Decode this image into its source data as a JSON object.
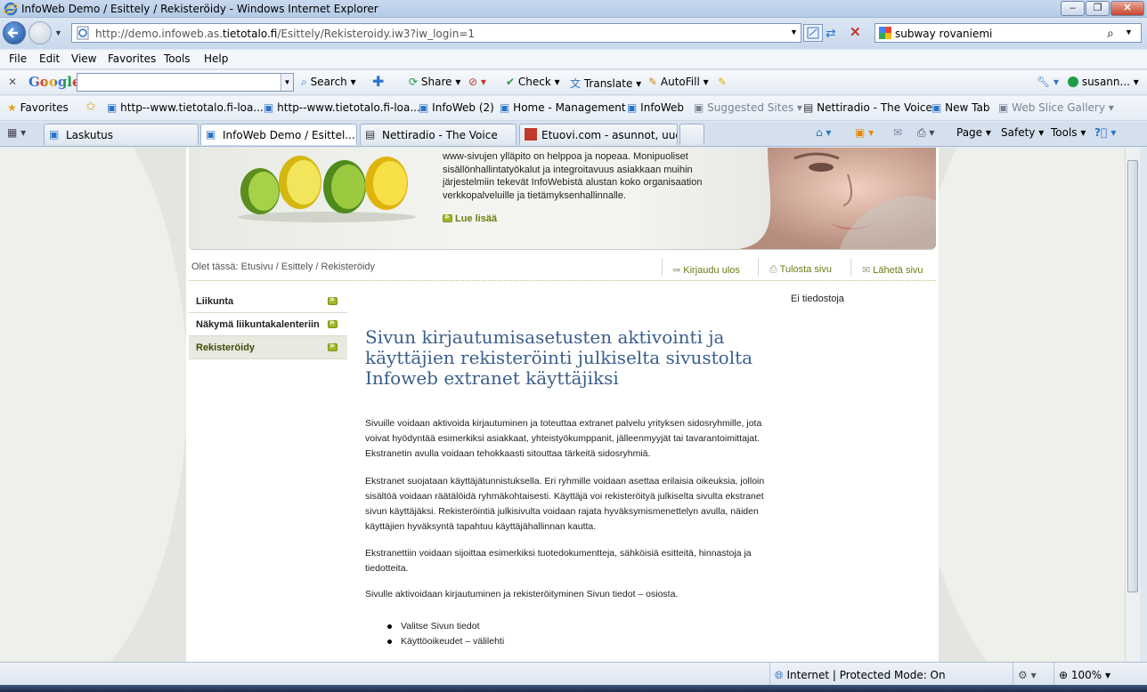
{
  "window": {
    "title": "InfoWeb Demo / Esittely / Rekisteröidy - Windows Internet Explorer"
  },
  "address": {
    "url_prefix": "http://demo.infoweb.as.",
    "url_domain": "tietotalo.fi",
    "url_suffix": "/Esittely/Rekisteroidy.iw3?iw_login=1"
  },
  "search": {
    "value": "subway rovaniemi"
  },
  "menu": [
    "File",
    "Edit",
    "View",
    "Favorites",
    "Tools",
    "Help"
  ],
  "google_toolbar": {
    "logo": "Google",
    "search_label": "Search",
    "share_label": "Share",
    "check_label": "Check",
    "translate_label": "Translate",
    "autofill_label": "AutoFill",
    "user_label": "susann..."
  },
  "favorites": {
    "label": "Favorites",
    "items": [
      "http--www.tietotalo.fi-loa...",
      "http--www.tietotalo.fi-loa...",
      "InfoWeb (2)",
      "Home - Management",
      "InfoWeb",
      "Suggested Sites",
      "Nettiradio - The Voice",
      "New Tab",
      "Web Slice Gallery"
    ]
  },
  "tabs": [
    {
      "label": "Laskutus"
    },
    {
      "label": "InfoWeb Demo / Esittel..."
    },
    {
      "label": "Nettiradio - The Voice"
    },
    {
      "label": "Etuovi.com - asunnot, uud..."
    }
  ],
  "command_bar": {
    "page": "Page",
    "safety": "Safety",
    "tools": "Tools"
  },
  "banner": {
    "text": "www-sivujen ylläpito on helppoa ja nopeaa. Monipuoliset sisällönhallintatyökalut ja integroitavuus asiakkaan muihin järjestelmiin tekevät InfoWebistä alustan koko organisaation verkkopalveluille ja tietämyksenhallinnalle.",
    "read_more": "Lue lisää"
  },
  "breadcrumb": "Olet tässä: Etusivu / Esittely / Rekisteröidy",
  "actions": {
    "logout": "Kirjaudu ulos",
    "print": "Tulosta sivu",
    "send": "Lähetä sivu"
  },
  "left_nav": [
    {
      "label": "Liikunta"
    },
    {
      "label": "Näkymä liikuntakalenteriin"
    },
    {
      "label": "Rekisteröidy"
    }
  ],
  "main": {
    "title": "Sivun kirjautumisasetusten aktivointi ja käyttäjien rekisteröinti julkiselta sivustolta Infoweb extranet käyttäjiksi",
    "paragraphs": [
      "Sivuille voidaan aktivoida kirjautuminen ja toteuttaa extranet palvelu yrityksen sidosryhmille, jota voivat hyödyntää esimerkiksi asiakkaat, yhteistyökumppanit, jälleenmyyjät tai tavarantoimittajat. Ekstranetin avulla voidaan tehokkaasti sitouttaa tärkeitä sidosryhmiä.",
      "Ekstranet suojataan käyttäjätunnistuksella. Eri ryhmille voidaan asettaa erilaisia oikeuksia, jolloin sisältöä voidaan räätälöidä ryhmäkohtaisesti. Käyttäjä voi rekisteröityä julkiselta sivulta ekstranet sivun käyttäjäksi. Rekisteröintiä julkisivulta voidaan rajata hyväksymismenettelyn avulla, näiden käyttäjien hyväksyntä tapahtuu käyttäjähallinnan kautta.",
      "Ekstranettiin voidaan sijoittaa esimerkiksi tuotedokumentteja, sähköisiä esitteitä, hinnastoja ja tiedotteita.",
      "Sivulle aktivoidaan kirjautuminen ja rekisteröityminen Sivun tiedot – osiosta."
    ],
    "bullets": [
      "Valitse Sivun tiedot",
      "Käyttöoikeudet – välilehti"
    ]
  },
  "sidebox": "Ei tiedostoja",
  "status": {
    "zone": "Internet | Protected Mode: On",
    "zoom": "100%"
  },
  "colors": {
    "accent_green": "#6b7d13",
    "title_blue": "#3a5f8c"
  }
}
